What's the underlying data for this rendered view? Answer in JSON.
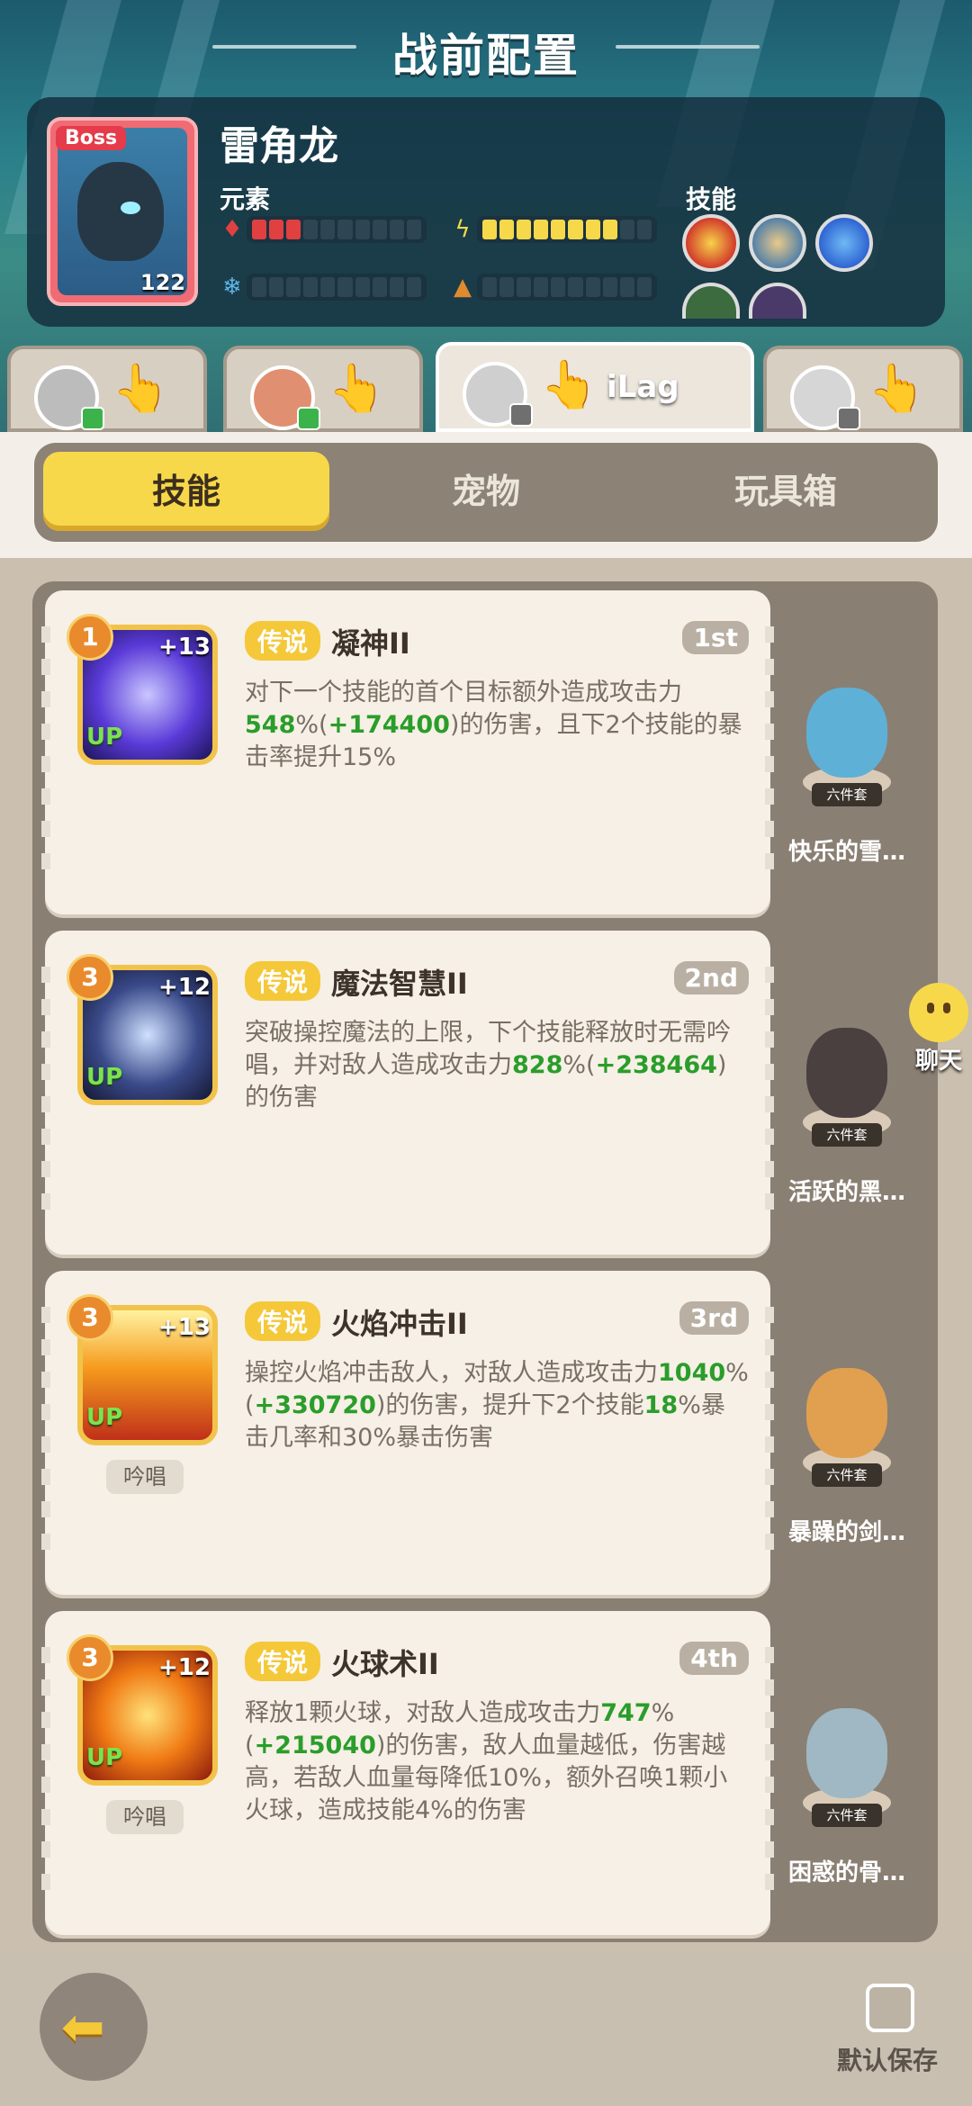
{
  "header": {
    "title": "战前配置"
  },
  "boss": {
    "tag": "Boss",
    "level": "122",
    "name": "雷角龙",
    "element_label": "元素",
    "skills_label": "技能",
    "bars": [
      {
        "icon": "fire-icon",
        "color": "#e04040",
        "filled": 3,
        "total": 10
      },
      {
        "icon": "lightning-icon",
        "color": "#f5d94a",
        "filled": 8,
        "total": 10
      },
      {
        "icon": "snowflake-icon",
        "color": "#5fb6e8",
        "filled": 0,
        "total": 10
      },
      {
        "icon": "earth-icon",
        "color": "#e08a30",
        "filled": 0,
        "total": 10
      }
    ]
  },
  "players": [
    {
      "name": "",
      "badge": "green"
    },
    {
      "name": "",
      "badge": "green"
    },
    {
      "name": "iLag",
      "badge": "gray",
      "active": true
    },
    {
      "name": "",
      "badge": "gray"
    }
  ],
  "subtabs": [
    "技能",
    "宠物",
    "玩具箱"
  ],
  "skills": [
    {
      "rank": "1",
      "plus": "+13",
      "up": "UP",
      "tag": "传说",
      "name": "凝神II",
      "order": "1st",
      "chant": "",
      "desc_parts": [
        {
          "t": "对下一个技能的首个目标额外造成攻击力",
          "g": false
        },
        {
          "t": "548",
          "g": true
        },
        {
          "t": "%(",
          "g": false
        },
        {
          "t": "+174400",
          "g": true
        },
        {
          "t": ")的伤害，且下2个技能的暴击率提升15%",
          "g": false
        }
      ],
      "pet": "快乐的雪…",
      "pet_set": "六件套"
    },
    {
      "rank": "3",
      "plus": "+12",
      "up": "UP",
      "tag": "传说",
      "name": "魔法智慧II",
      "order": "2nd",
      "chant": "",
      "desc_parts": [
        {
          "t": "突破操控魔法的上限，下个技能释放时无需吟唱，并对敌人造成攻击力",
          "g": false
        },
        {
          "t": "828",
          "g": true
        },
        {
          "t": "%(",
          "g": false
        },
        {
          "t": "+238464",
          "g": true
        },
        {
          "t": ")的伤害",
          "g": false
        }
      ],
      "pet": "活跃的黑…",
      "pet_set": "六件套"
    },
    {
      "rank": "3",
      "plus": "+13",
      "up": "UP",
      "tag": "传说",
      "name": "火焰冲击II",
      "order": "3rd",
      "chant": "吟唱",
      "desc_parts": [
        {
          "t": "操控火焰冲击敌人，对敌人造成攻击力",
          "g": false
        },
        {
          "t": "1040",
          "g": true
        },
        {
          "t": "%(",
          "g": false
        },
        {
          "t": "+330720",
          "g": true
        },
        {
          "t": ")的伤害，提升下2个技能",
          "g": false
        },
        {
          "t": "18",
          "g": true
        },
        {
          "t": "%暴击几率和30%暴击伤害",
          "g": false
        }
      ],
      "pet": "暴躁的剑…",
      "pet_set": "六件套"
    },
    {
      "rank": "3",
      "plus": "+12",
      "up": "UP",
      "tag": "传说",
      "name": "火球术II",
      "order": "4th",
      "chant": "吟唱",
      "desc_parts": [
        {
          "t": "释放1颗火球，对敌人造成攻击力",
          "g": false
        },
        {
          "t": "747",
          "g": true
        },
        {
          "t": "%(",
          "g": false
        },
        {
          "t": "+215040",
          "g": true
        },
        {
          "t": ")的伤害，敌人血量越低，伤害越高，若敌人血量每降低10%，额外召唤1颗小火球，造成技能4%的伤害",
          "g": false
        }
      ],
      "pet": "困惑的骨…",
      "pet_set": "六件套"
    }
  ],
  "chat": {
    "label": "聊天"
  },
  "footer": {
    "save_label": "默认保存"
  }
}
